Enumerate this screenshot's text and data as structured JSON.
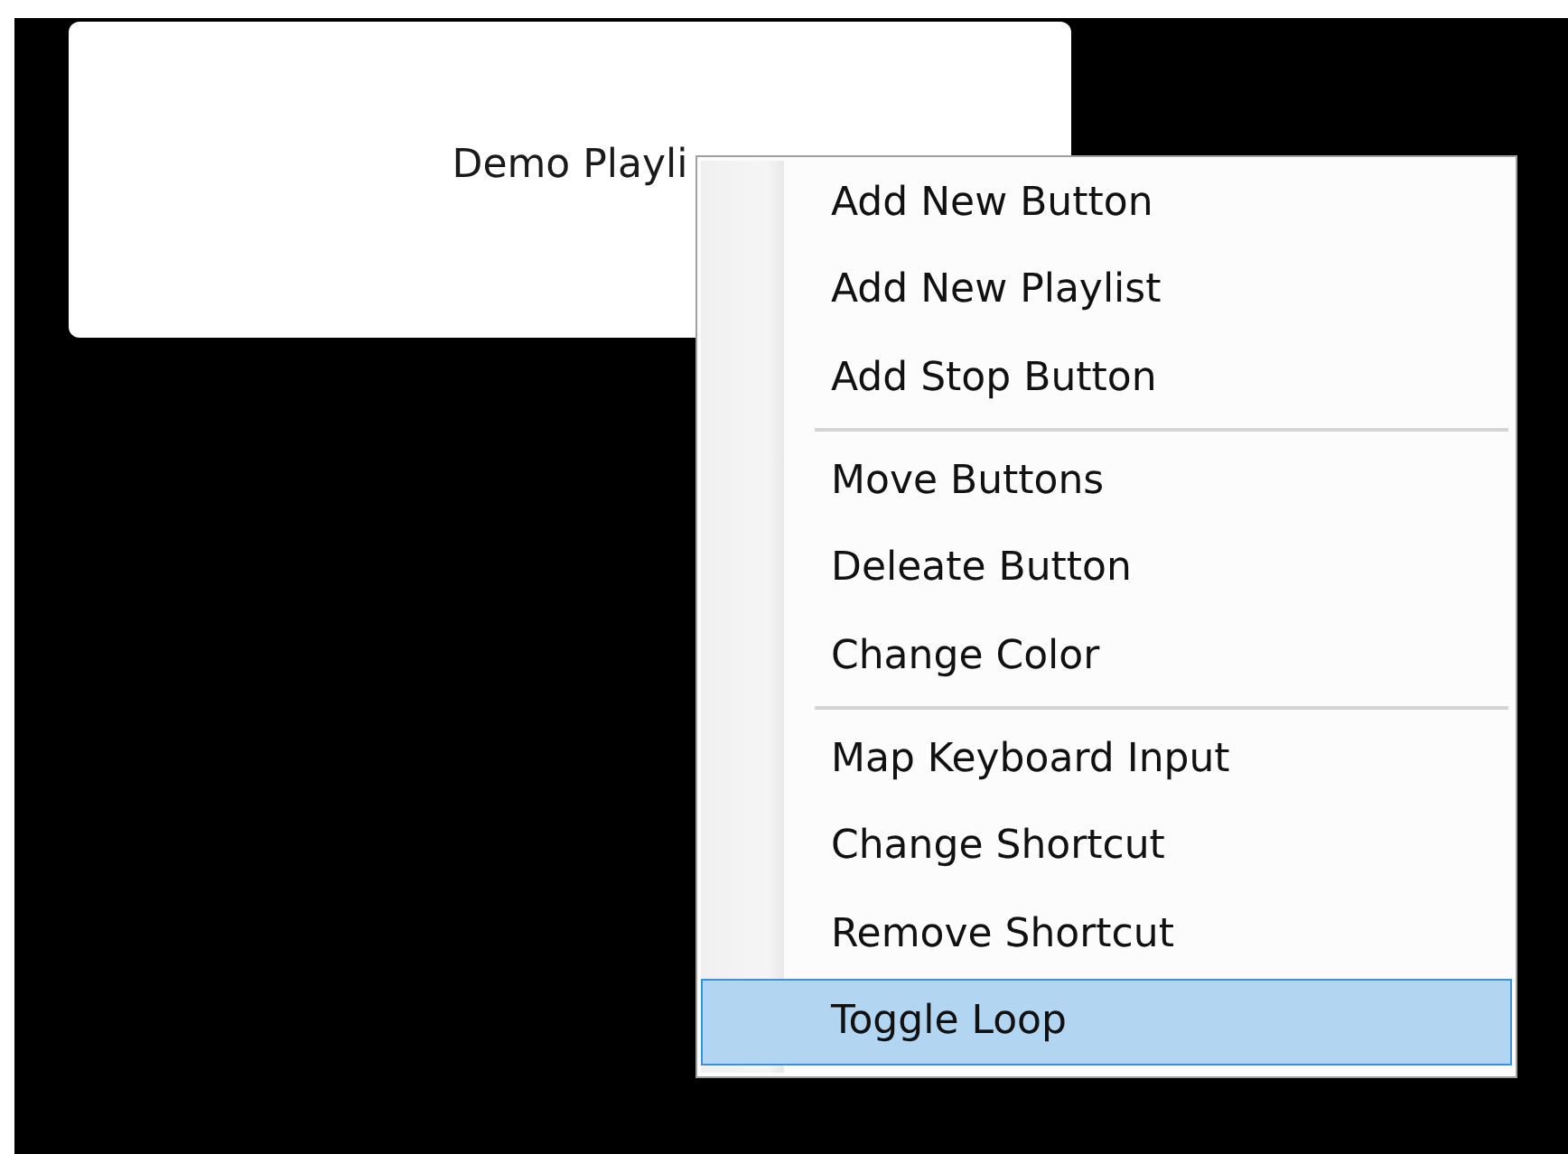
{
  "playlist_button": {
    "label": "Demo Playli"
  },
  "context_menu": {
    "groups": [
      [
        {
          "label": "Add New Button",
          "selected": false
        },
        {
          "label": "Add New Playlist",
          "selected": false
        },
        {
          "label": "Add Stop Button",
          "selected": false
        }
      ],
      [
        {
          "label": "Move Buttons",
          "selected": false
        },
        {
          "label": "Deleate Button",
          "selected": false
        },
        {
          "label": "Change Color",
          "selected": false
        }
      ],
      [
        {
          "label": "Map Keyboard Input",
          "selected": false
        },
        {
          "label": "Change Shortcut",
          "selected": false
        },
        {
          "label": "Remove Shortcut",
          "selected": false
        },
        {
          "label": "Toggle Loop",
          "selected": true
        }
      ]
    ]
  }
}
